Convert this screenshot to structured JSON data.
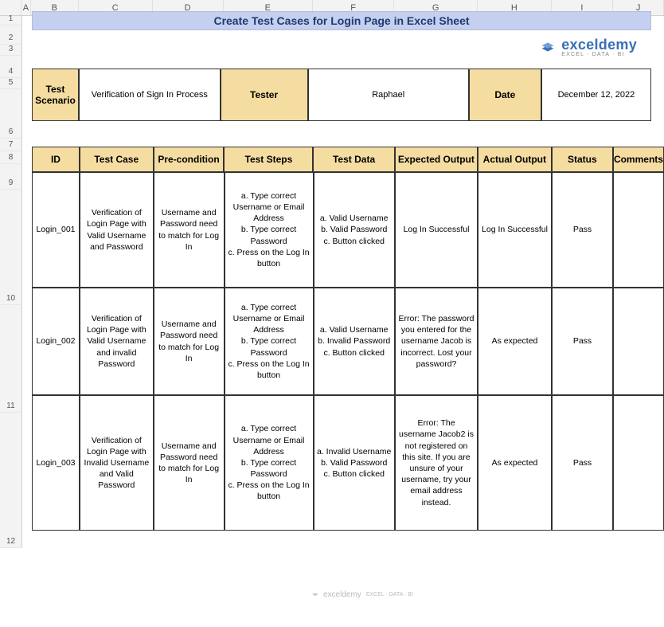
{
  "cols": [
    "A",
    "B",
    "C",
    "D",
    "E",
    "F",
    "G",
    "H",
    "I",
    "J"
  ],
  "rows_left": [
    {
      "n": "1",
      "h": 12
    },
    {
      "n": "2",
      "h": 24
    },
    {
      "n": "3",
      "h": 14
    },
    {
      "n": "4",
      "h": 28
    },
    {
      "n": "5",
      "h": 14
    },
    {
      "n": "6",
      "h": 62
    },
    {
      "n": "7",
      "h": 16
    },
    {
      "n": "8",
      "h": 16
    },
    {
      "n": "9",
      "h": 32
    },
    {
      "n": "10",
      "h": 145
    },
    {
      "n": "11",
      "h": 135
    },
    {
      "n": "12",
      "h": 170
    }
  ],
  "title": "Create Test Cases for Login Page in Excel Sheet",
  "logo": {
    "text": "exceldemy",
    "sub": "EXCEL · DATA · BI"
  },
  "info": {
    "scenario_label": "Test Scenario",
    "scenario_value": "Verification of Sign In Process",
    "tester_label": "Tester",
    "tester_value": "Raphael",
    "date_label": "Date",
    "date_value": "December 12, 2022"
  },
  "headers": {
    "id": "ID",
    "tc": "Test Case",
    "pre": "Pre-condition",
    "steps": "Test Steps",
    "data": "Test Data",
    "exp": "Expected Output",
    "act": "Actual Output",
    "status": "Status",
    "comments": "Comments"
  },
  "rows": [
    {
      "id": "Login_001",
      "tc": "Verification of Login Page with Valid Username and Password",
      "pre": "Username and Password need to match for Log In",
      "steps": "a. Type correct Username or Email Address\nb. Type correct Password\nc. Press on the Log In button",
      "data": "a. Valid Username\nb. Valid Password\nc. Button clicked",
      "exp": "Log In Successful",
      "act": "Log In Successful",
      "status": "Pass",
      "comments": ""
    },
    {
      "id": "Login_002",
      "tc": "Verification of Login Page with Valid Username and invalid Password",
      "pre": "Username and Password need to match for Log In",
      "steps": "a. Type correct Username or Email Address\nb. Type correct Password\nc. Press on the Log In button",
      "data": "a. Valid Username\nb. Invalid Password\nc. Button clicked",
      "exp": "Error: The password you entered for the username Jacob is incorrect. Lost your password?",
      "act": "As expected",
      "status": "Pass",
      "comments": ""
    },
    {
      "id": "Login_003",
      "tc": "Verification of Login Page with Invalid Username and Valid Password",
      "pre": "Username and Password need to match for Log In",
      "steps": "a. Type correct Username or Email Address\nb. Type correct Password\nc. Press on the Log In button",
      "data": "a. Invalid Username\nb. Valid Password\nc. Button clicked",
      "exp": "Error: The username Jacob2 is not registered on this site. If you are unsure of your username, try your email address instead.",
      "act": "As expected",
      "status": "Pass",
      "comments": ""
    }
  ],
  "watermark": "exceldemy"
}
